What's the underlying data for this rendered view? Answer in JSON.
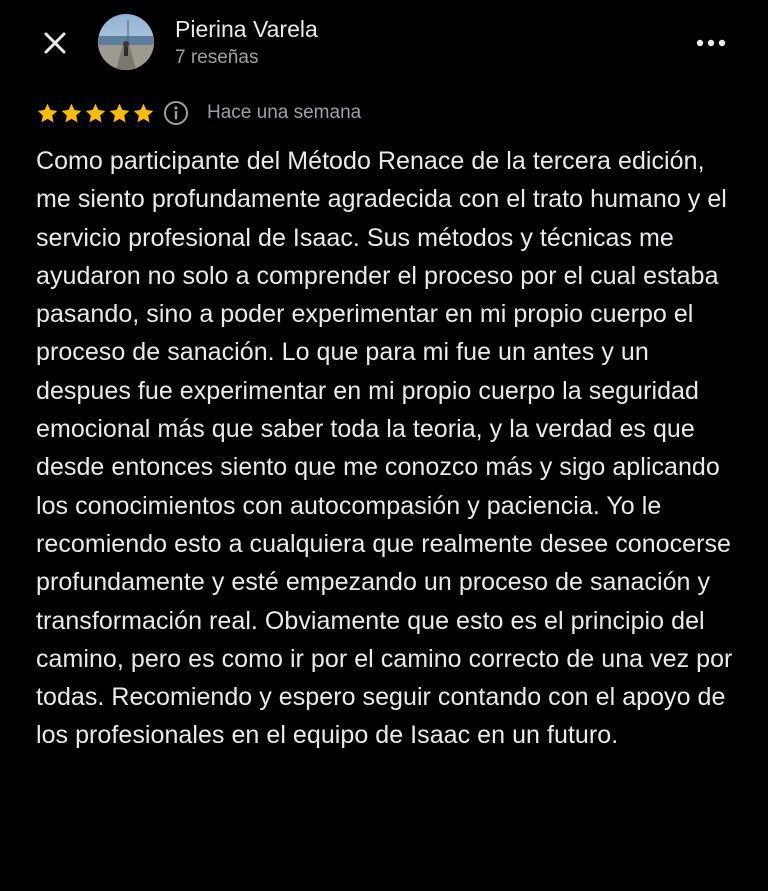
{
  "header": {
    "close_icon": "close-icon",
    "reviewer_name": "Pierina Varela",
    "review_count": "7 reseñas",
    "more_icon": "more-horizontal-icon"
  },
  "review": {
    "rating": 5,
    "max_rating": 5,
    "star_color": "#fbbc04",
    "info_icon": "info-icon",
    "time_ago": "Hace una semana",
    "text": "Como participante del Método Renace de la tercera edición, me siento profundamente agradecida con el trato humano y el servicio profesional de Isaac. Sus métodos y técnicas me ayudaron no solo a comprender el proceso por el cual estaba pasando, sino a poder experimentar en mi propio cuerpo el proceso de sanación. Lo que para mi fue un antes y un despues fue experimentar en mi propio cuerpo la seguridad emocional más que saber toda la teoria, y la verdad es que desde entonces siento que me conozco más y sigo aplicando los conocimientos con autocompasión y paciencia. Yo le recomiendo esto a cualquiera que realmente desee conocerse profundamente y esté empezando un proceso de sanación y transformación real. Obviamente que esto es el principio del camino, pero es como ir por el camino correcto de una vez por todas. Recomiendo y espero seguir contando con el apoyo de los profesionales en el equipo de Isaac en un futuro."
  },
  "colors": {
    "background": "#000000",
    "primary_text": "#e8eaed",
    "secondary_text": "#9aa0a6",
    "star": "#fbbc04"
  }
}
